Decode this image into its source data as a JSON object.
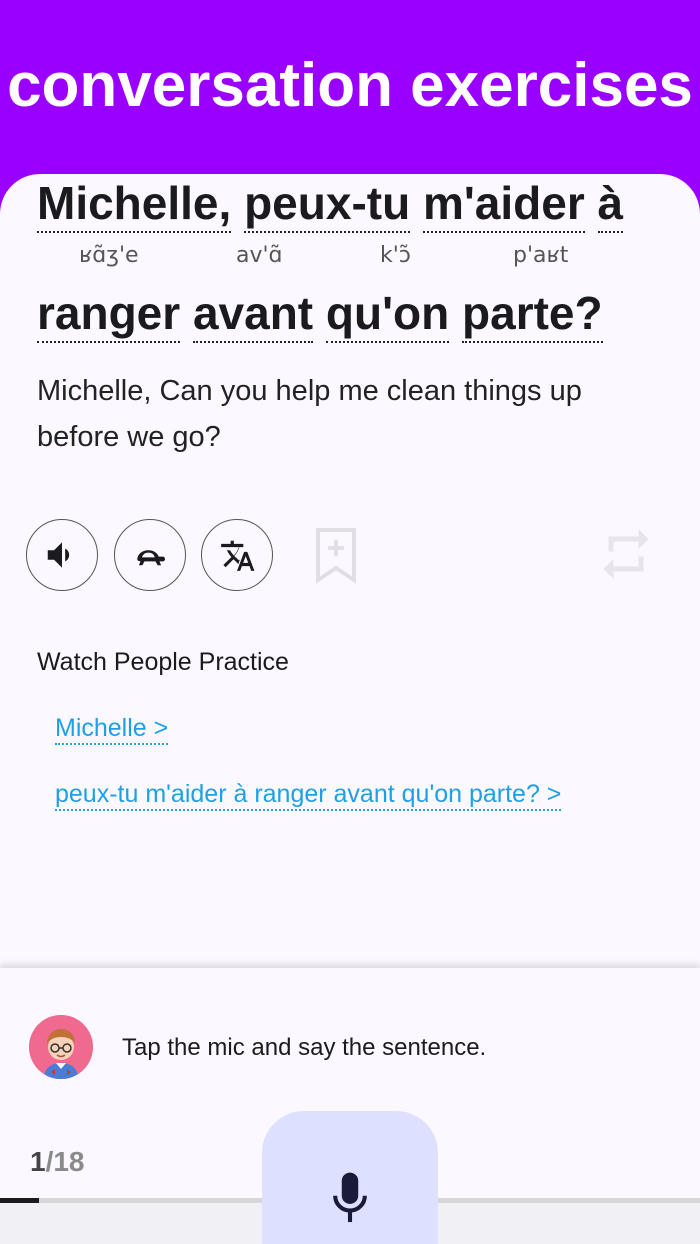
{
  "header": {
    "title": "conversation exercises"
  },
  "sentence": {
    "line1_words": [
      "Michelle,",
      "peux-tu",
      "m'aider",
      "à"
    ],
    "line2_words": [
      "ranger",
      "avant",
      "qu'on",
      "parte?"
    ],
    "ipa": [
      "ʁɑ̃ʒ'e",
      "av'ɑ̃",
      "k'ɔ̃",
      "p'aʁt"
    ],
    "translation": "Michelle, Can you help me clean things up before we go?"
  },
  "actions": {
    "icons": [
      "speaker-icon",
      "turtle-icon",
      "translate-icon",
      "bookmark-add-icon",
      "repeat-icon"
    ]
  },
  "practice": {
    "title": "Watch People Practice",
    "links": [
      "Michelle >",
      "peux-tu m'aider à ranger avant qu'on parte? >"
    ]
  },
  "footer": {
    "prompt": "Tap the mic and say the sentence.",
    "current": "1",
    "total": "/18",
    "progress": 0.055
  },
  "colors": {
    "header": "#9a00ff",
    "link": "#1ea0e6",
    "mic_bg": "#dde0ff",
    "mic_icon": "#1a1a3a"
  }
}
